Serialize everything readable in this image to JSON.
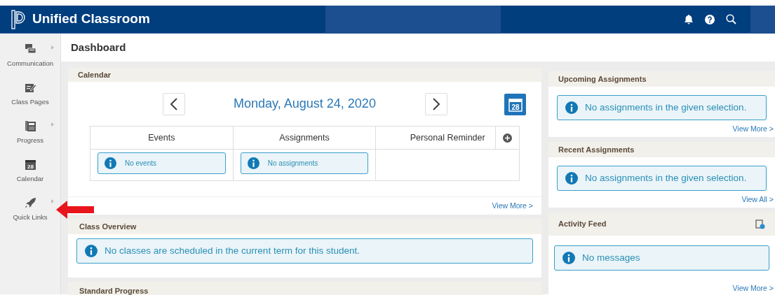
{
  "header": {
    "app_title": "Unified Classroom"
  },
  "sidebar": {
    "items": [
      {
        "label": "Communication",
        "has_submenu": true
      },
      {
        "label": "Class Pages",
        "has_submenu": false
      },
      {
        "label": "Progress",
        "has_submenu": true
      },
      {
        "label": "Calendar",
        "icon_text": "28",
        "has_submenu": false
      },
      {
        "label": "Quick Links",
        "has_submenu": true
      }
    ]
  },
  "page_title": "Dashboard",
  "calendar": {
    "title": "Calendar",
    "date": "Monday, August 24, 2020",
    "picker_icon_text": "28",
    "columns": [
      "Events",
      "Assignments",
      "Personal Reminder"
    ],
    "cells": [
      "No events",
      "No assignments",
      ""
    ],
    "link": "View More >"
  },
  "class_overview": {
    "title": "Class Overview",
    "message": "No classes are scheduled in the current term for this student."
  },
  "standard_progress": {
    "title": "Standard Progress"
  },
  "right_panels": [
    {
      "title": "Upcoming Assignments",
      "message": "No assignments in the given selection.",
      "link": "View More >",
      "has_action_icon": false
    },
    {
      "title": "Recent Assignments",
      "message": "No assignments in the given selection.",
      "link": "View All >",
      "has_action_icon": false
    },
    {
      "title": "Activity Feed",
      "message": "No messages",
      "link": "View More >",
      "has_action_icon": true
    }
  ]
}
